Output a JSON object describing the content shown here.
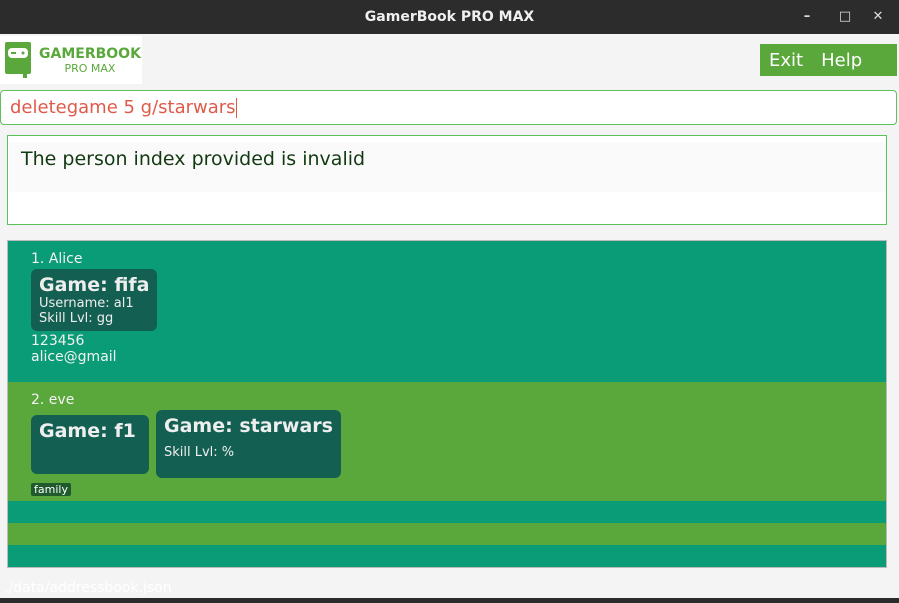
{
  "window": {
    "title": "GamerBook PRO MAX",
    "minimize": "–",
    "maximize": "□",
    "close": "✕"
  },
  "logo": {
    "line1": "GAMERBOOK",
    "line2": "PRO MAX"
  },
  "menu": {
    "exit": "Exit",
    "help": "Help"
  },
  "command": {
    "value": "deletegame 5 g/starwars"
  },
  "result": {
    "message": "The person index provided is invalid"
  },
  "persons": [
    {
      "index": "1. Alice",
      "games": [
        {
          "title": "Game: fifa",
          "username": "Username: al1",
          "skill": "Skill Lvl: gg"
        }
      ],
      "phone": "123456",
      "email": "alice@gmail"
    },
    {
      "index": "2. eve",
      "games": [
        {
          "title": "Game: f1"
        },
        {
          "title": "Game: starwars",
          "skill": "Skill Lvl: %"
        }
      ],
      "tag": "family"
    }
  ],
  "status": {
    "path": "./data/addressbook.json"
  },
  "colors": {
    "accent": "#5aa83c",
    "teal": "#0a9b77",
    "card": "#135f52",
    "error": "#e05a4a"
  }
}
